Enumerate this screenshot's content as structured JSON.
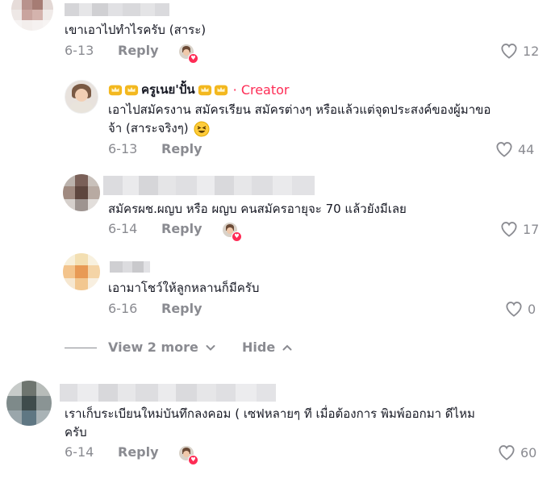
{
  "comments": [
    {
      "text": "เขาเอาไปทำไรครับ (สาระ)",
      "date": "6-13",
      "reply": "Reply",
      "likes": "12"
    },
    {
      "author": "ครูเนย'ปั้น",
      "creator_label": "· Creator",
      "text_line1": "เอาไปสมัครงาน สมัครเรียน สมัครต่างๆ หรือแล้วแต่จุดประสงค์ของผู้มาขอ",
      "text_line2": "จ้า (สาระจริงๆ)",
      "date": "6-13",
      "reply": "Reply",
      "likes": "44"
    },
    {
      "text": "สมัครผช.ผญบ หรือ ผญบ คนสมัครอายุจะ 70 แล้วยังมีเลย",
      "date": "6-14",
      "reply": "Reply",
      "likes": "17"
    },
    {
      "text": "เอามาโชว์ให้ลูกหลานก็มีครับ",
      "date": "6-16",
      "reply": "Reply",
      "likes": "0"
    },
    {
      "text_line1": "เราเก็บระเบียนใหม่บันทึกลงคอม ( เซฟหลายๆ ที เมื่อต้องการ พิมพ์ออกมา ดีไหม",
      "text_line2": "ครับ",
      "date": "6-14",
      "reply": "Reply",
      "likes": "60"
    }
  ],
  "thread": {
    "view_more": "View 2 more",
    "hide": "Hide"
  },
  "colors": {
    "accent": "#fe2c55",
    "muted": "#8a8b91",
    "text": "#161823"
  }
}
